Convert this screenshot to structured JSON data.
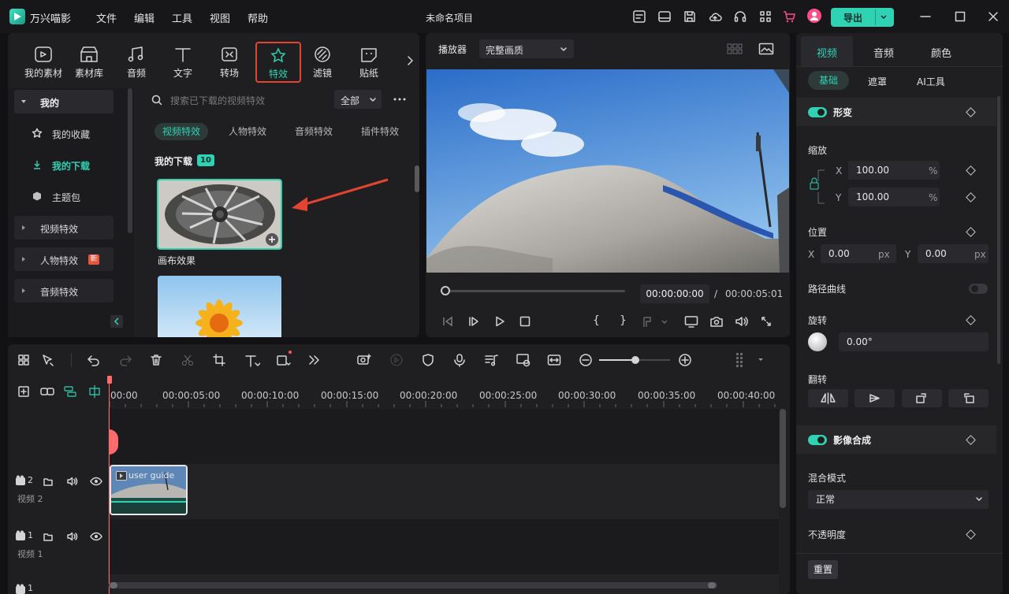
{
  "app": {
    "name": "万兴喵影",
    "project_title": "未命名项目",
    "export_label": "导出"
  },
  "menu": [
    "文件",
    "编辑",
    "工具",
    "视图",
    "帮助"
  ],
  "toolbar_tabs": [
    {
      "label": "我的素材",
      "icon": "my-media-icon"
    },
    {
      "label": "素材库",
      "icon": "stock-library-icon"
    },
    {
      "label": "音频",
      "icon": "audio-icon"
    },
    {
      "label": "文字",
      "icon": "text-icon"
    },
    {
      "label": "转场",
      "icon": "transition-icon"
    },
    {
      "label": "特效",
      "icon": "effects-icon",
      "active": true
    },
    {
      "label": "滤镜",
      "icon": "filter-icon"
    },
    {
      "label": "贴纸",
      "icon": "sticker-icon"
    }
  ],
  "sidebar": {
    "items": [
      {
        "label": "我的",
        "kind": "group-open"
      },
      {
        "label": "我的收藏",
        "icon": "star-icon"
      },
      {
        "label": "我的下载",
        "icon": "download-icon",
        "active": true
      },
      {
        "label": "主题包",
        "icon": "box-icon"
      },
      {
        "label": "视频特效",
        "kind": "group"
      },
      {
        "label": "人物特效",
        "kind": "group",
        "badge": "新"
      },
      {
        "label": "音频特效",
        "kind": "group"
      }
    ]
  },
  "effects": {
    "search_placeholder": "搜索已下载的视频特效",
    "filter_value": "全部",
    "categories": [
      "视频特效",
      "人物特效",
      "音频特效",
      "插件特效"
    ],
    "section_title": "我的下载",
    "section_count": "10",
    "items": [
      {
        "label": "画布效果"
      }
    ]
  },
  "player": {
    "label": "播放器",
    "quality": "完整画质",
    "current_time": "00:00:00:00",
    "separator": "/",
    "total_time": "00:00:05:01"
  },
  "right_panel": {
    "tabs": [
      "视频",
      "音频",
      "颜色"
    ],
    "subtabs": [
      "基础",
      "遮罩",
      "AI工具"
    ],
    "transform_title": "形变",
    "scale_label": "缩放",
    "scale_x": "100.00",
    "scale_y": "100.00",
    "percent": "%",
    "position_label": "位置",
    "pos_x": "0.00",
    "pos_y": "0.00",
    "px": "px",
    "x": "X",
    "y": "Y",
    "path_curve_label": "路径曲线",
    "rotate_label": "旋转",
    "rotate_value": "0.00°",
    "flip_label": "翻转",
    "composite_title": "影像合成",
    "blend_label": "混合模式",
    "blend_value": "正常",
    "opacity_label": "不透明度",
    "reset_label": "重置"
  },
  "timeline": {
    "ruler": [
      "00:00",
      "00:00:05:00",
      "00:00:10:00",
      "00:00:15:00",
      "00:00:20:00",
      "00:00:25:00",
      "00:00:30:00",
      "00:00:35:00",
      "00:00:40:00"
    ],
    "tracks": [
      {
        "num": "2",
        "name": "视频 2"
      },
      {
        "num": "1",
        "name": "视频 1"
      },
      {
        "num": "1",
        "name": ""
      }
    ],
    "clip_label": "user guide"
  },
  "colors": {
    "accent": "#2fd3b4",
    "highlight_box": "#e2452f",
    "arrow": "#e2452f",
    "playhead": "#ff6a6a"
  }
}
